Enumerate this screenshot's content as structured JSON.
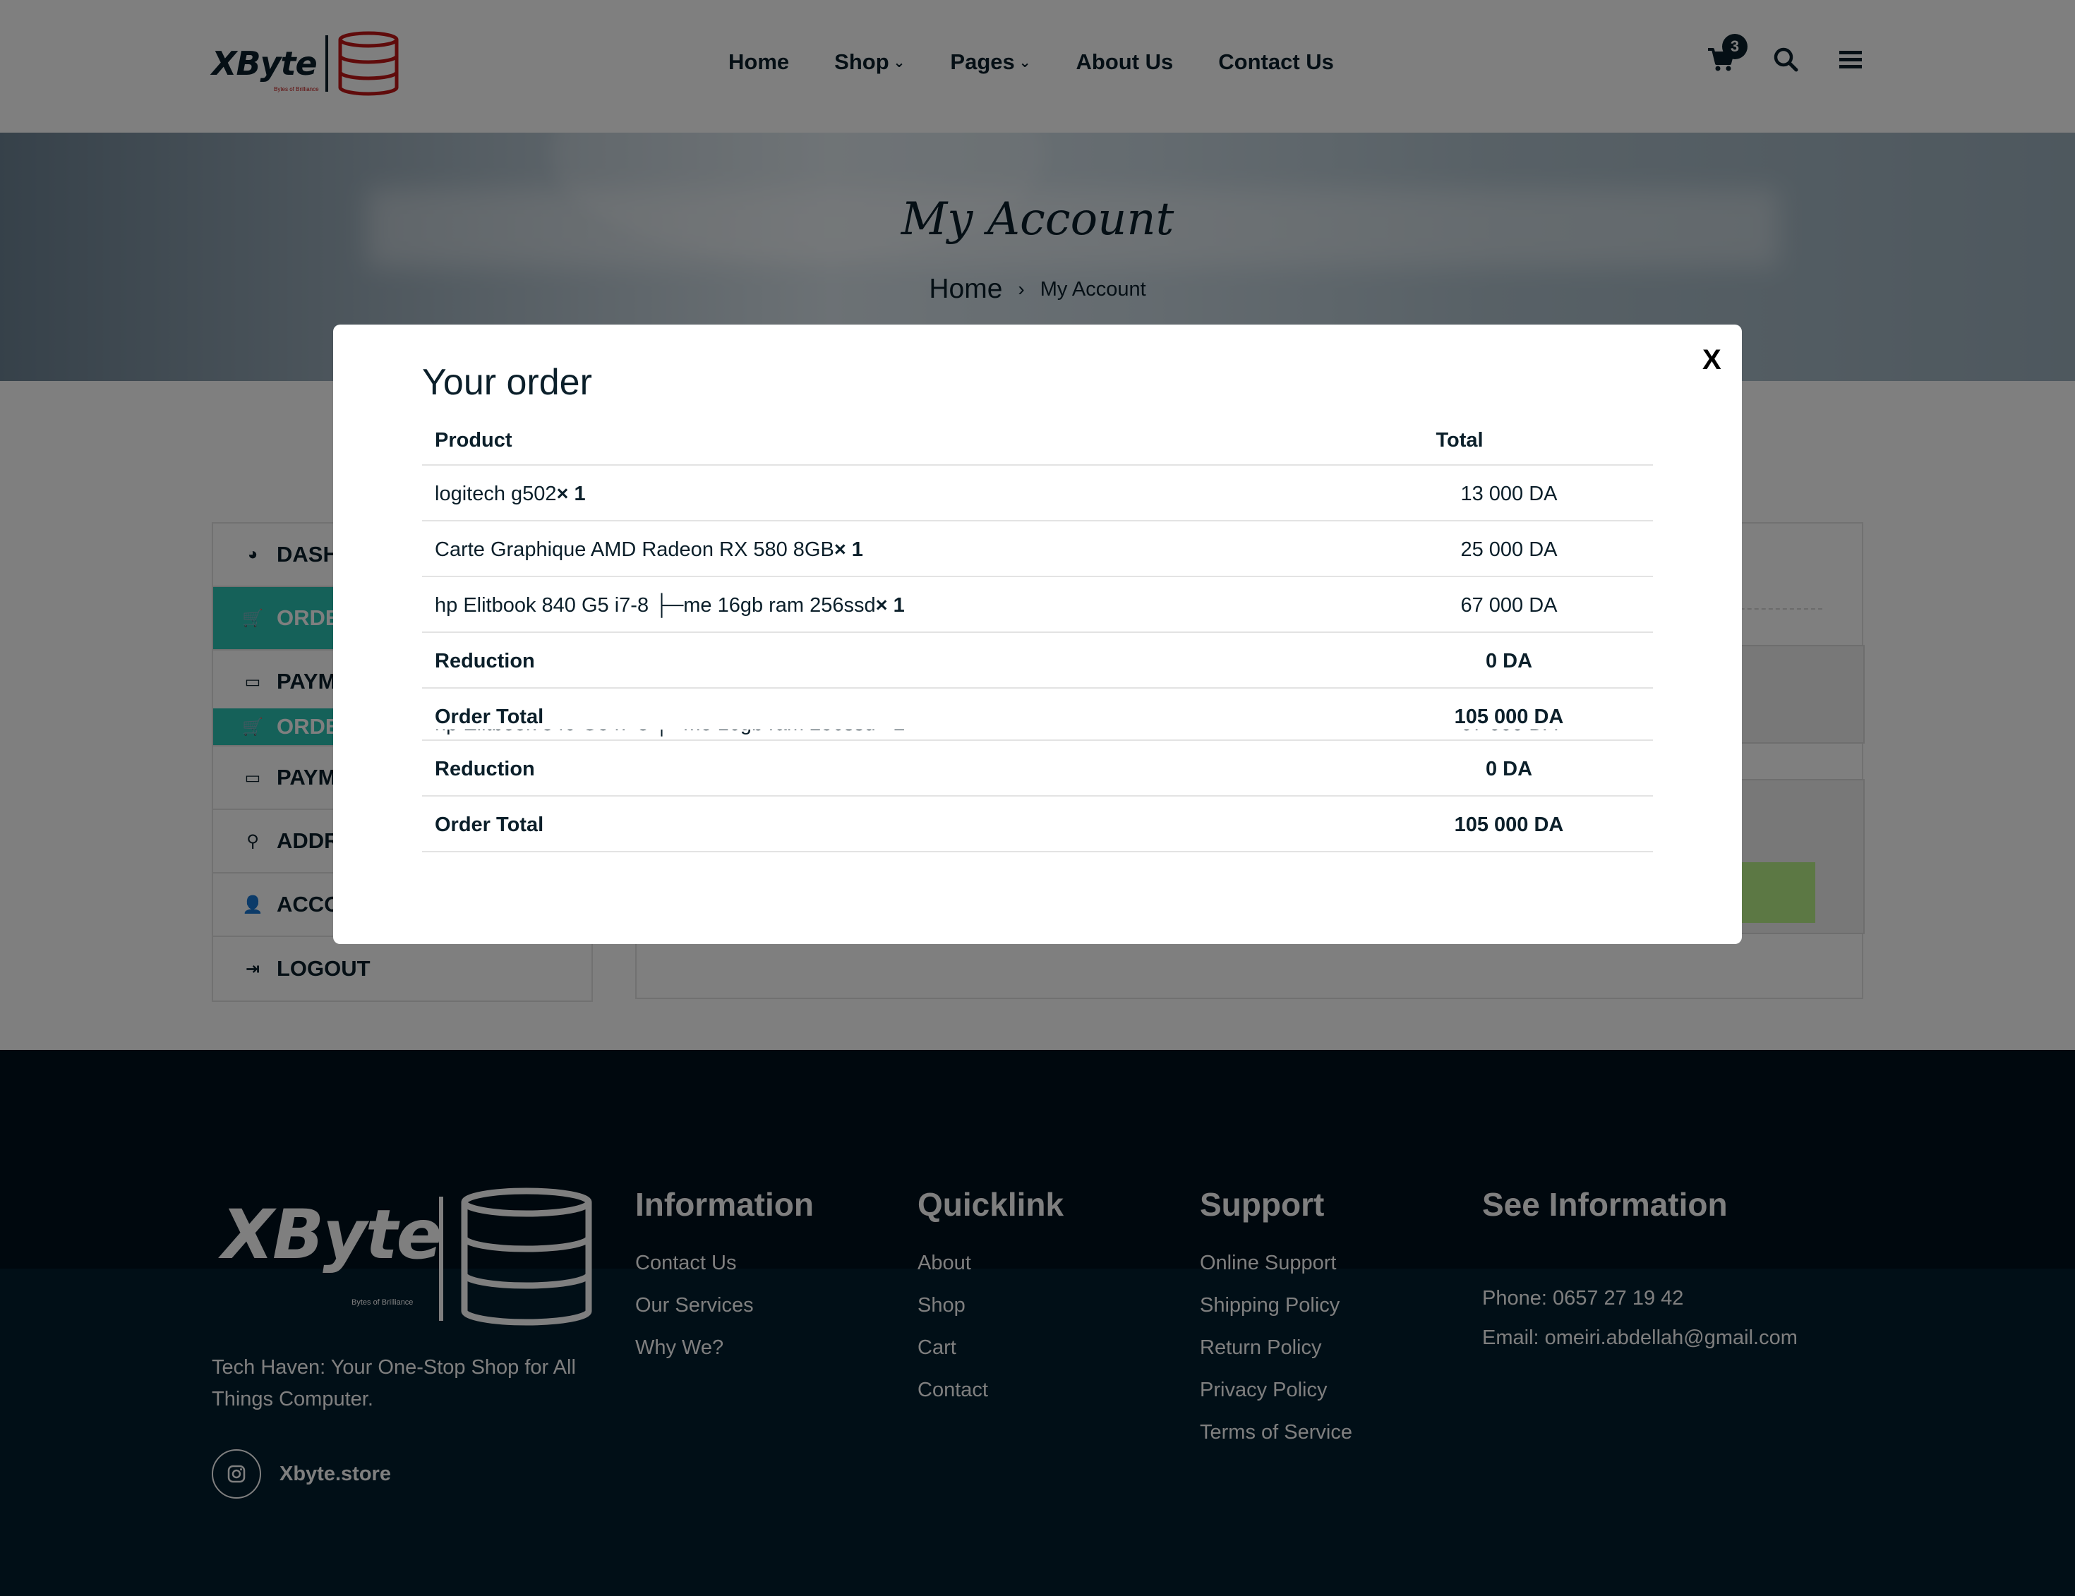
{
  "header": {
    "logo_text": "XByte",
    "logo_tagline": "Bytes of Brilliance",
    "nav": [
      "Home",
      "Shop",
      "Pages",
      "About Us",
      "Contact Us"
    ],
    "cart_count": "3"
  },
  "banner": {
    "title": "My Account",
    "breadcrumb_home": "Home",
    "breadcrumb_sep": "›",
    "breadcrumb_current": "My Account"
  },
  "sidebar": {
    "items": [
      {
        "label": "DASH",
        "icon": "dashboard-icon"
      },
      {
        "label": "ORDE",
        "icon": "cart-icon"
      },
      {
        "label": "PAYM",
        "icon": "credit-card-icon"
      },
      {
        "label": "ORDE",
        "icon": "cart-icon"
      },
      {
        "label": "PAYM",
        "icon": "credit-card-icon"
      },
      {
        "label": "ADDR",
        "icon": "map-pin-icon"
      },
      {
        "label": "ACCOUNT DETAILS",
        "icon": "user-icon"
      },
      {
        "label": "LOGOUT",
        "icon": "logout-icon"
      }
    ]
  },
  "modal": {
    "close_label": "X",
    "title": "Your order",
    "col_product": "Product",
    "col_total": "Total",
    "rows": [
      {
        "product": "logitech g502",
        "qty": "× 1",
        "total": "13 000 DA"
      },
      {
        "product": "Carte Graphique AMD Radeon RX 580 8GB",
        "qty": "× 1",
        "total": "25 000 DA"
      },
      {
        "product": "hp Elitbook 840 G5 i7-8 ├─me 16gb ram 256ssd",
        "qty": "× 1",
        "total": "67 000 DA"
      }
    ],
    "reduction_label": "Reduction",
    "reduction_value": "0 DA",
    "order_total_label": "Order Total",
    "order_total_value": "105 000 DA"
  },
  "footer": {
    "logo_text": "XByte",
    "logo_tagline": "Bytes of Brilliance",
    "tagline": "Tech Haven: Your One-Stop Shop for All Things Computer.",
    "social_handle": "Xbyte.store",
    "columns": [
      {
        "heading": "Information",
        "links": [
          "Contact Us",
          "Our Services",
          "Why We?"
        ]
      },
      {
        "heading": "Quicklink",
        "links": [
          "About",
          "Shop",
          "Cart",
          "Contact"
        ]
      },
      {
        "heading": "Support",
        "links": [
          "Online Support",
          "Shipping Policy",
          "Return Policy",
          "Privacy Policy",
          "Terms of Service"
        ]
      }
    ],
    "see_info_heading": "See Information",
    "phone": "Phone: 0657 27 19 42",
    "email": "Email: omeiri.abdellah@gmail.com"
  },
  "colors": {
    "accent_teal": "#2bc3b3",
    "dark_navy": "#031e2f",
    "logo_red": "#c01616"
  }
}
